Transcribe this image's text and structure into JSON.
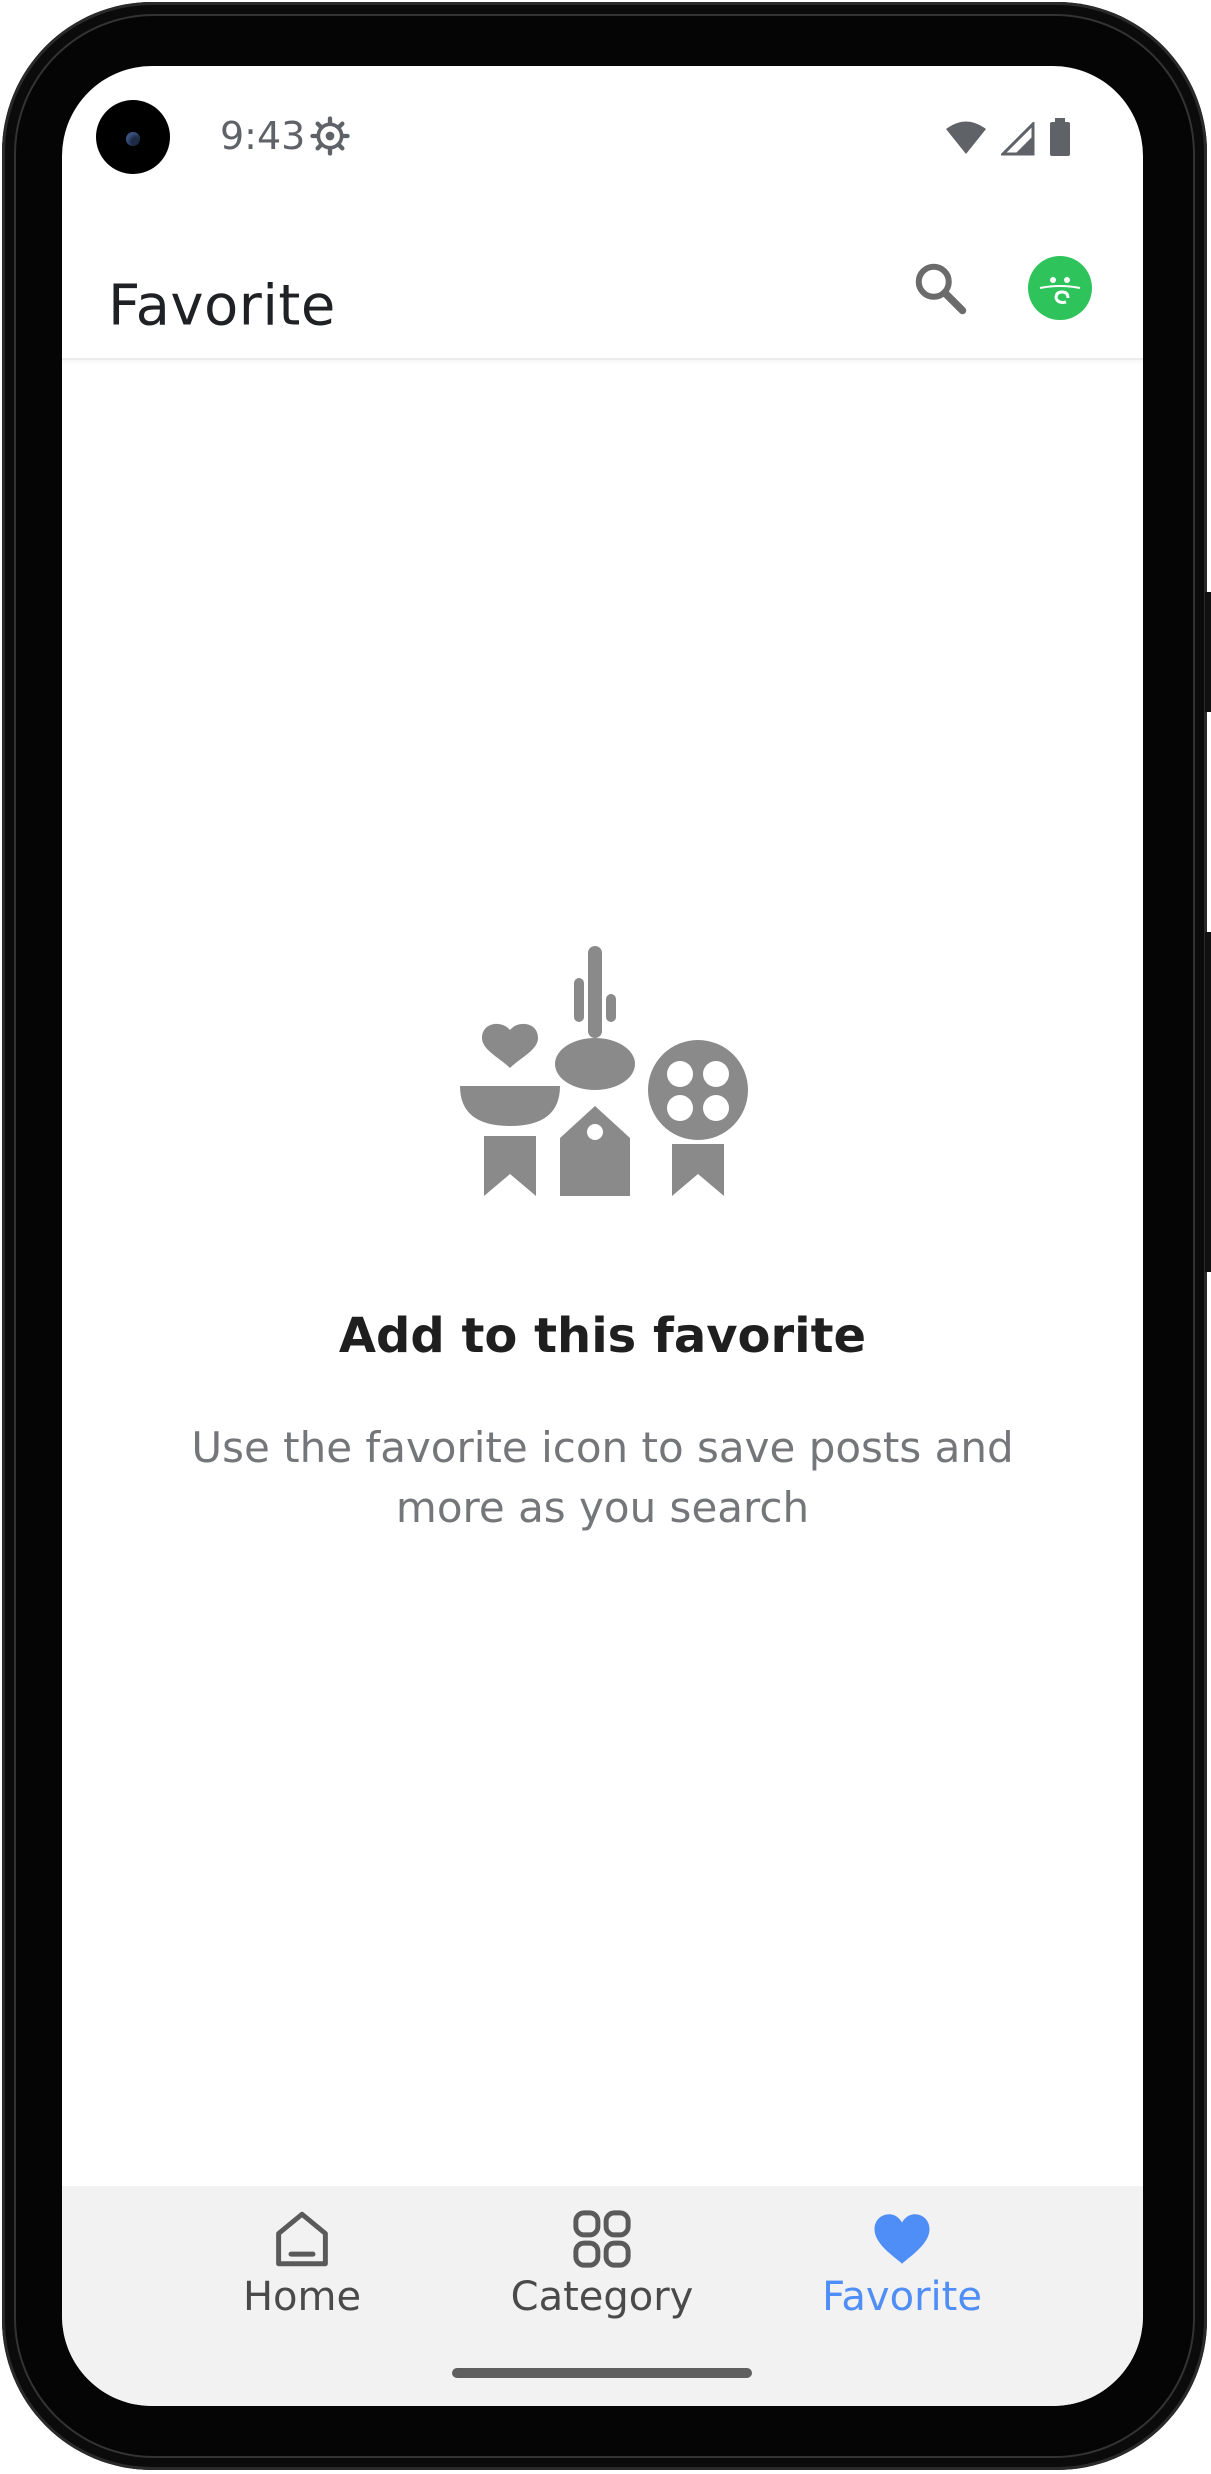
{
  "status_bar": {
    "time": "9:43",
    "icons": [
      "settings-gear-icon",
      "wifi-icon",
      "cellular-signal-icon",
      "battery-icon"
    ]
  },
  "app_bar": {
    "title": "Favorite",
    "search_icon": "search-icon",
    "avatar_icon": "android-avatar-icon",
    "avatar_color": "#2ec45b"
  },
  "empty_state": {
    "illustration": "favorites-badges-illustration",
    "title": "Add to this favorite",
    "description": "Use the favorite icon to save posts and more as you search"
  },
  "bottom_nav": {
    "items": [
      {
        "label": "Home",
        "icon": "home-icon",
        "active": false
      },
      {
        "label": "Category",
        "icon": "category-grid-icon",
        "active": false
      },
      {
        "label": "Favorite",
        "icon": "heart-icon",
        "active": true
      }
    ],
    "active_color": "#4f8ef7",
    "inactive_color": "#4a4a4a"
  }
}
